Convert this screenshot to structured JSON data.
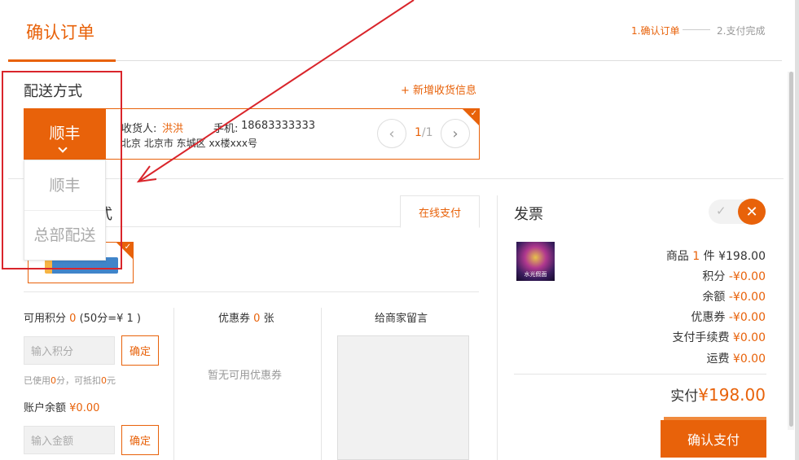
{
  "header": {
    "title": "确认订单",
    "step1": "1.确认订单",
    "step2": "2.支付完成"
  },
  "delivery": {
    "title": "配送方式",
    "add_address": "+ 新增收货信息",
    "selected": "顺丰",
    "options": [
      "顺丰",
      "总部配送"
    ]
  },
  "address": {
    "receiver_label": "收货人:",
    "receiver_name": "洪洪",
    "phone_label": "手机:",
    "phone": "18683333333",
    "line": "北京 北京市 东城区 xx楼xxx号",
    "page_current": "1",
    "page_total": "/1"
  },
  "payment": {
    "title_partial": "式",
    "tab_online": "在线支付"
  },
  "points": {
    "label": "可用积分",
    "count": "0",
    "rate": "(50分=¥ 1 )",
    "placeholder": "输入积分",
    "confirm": "确定",
    "used_prefix": "已使用",
    "used_points": "0",
    "used_mid": "分，可抵扣",
    "used_amount": "0",
    "used_suffix": "元"
  },
  "balance": {
    "label": "账户余额",
    "amount": "¥0.00",
    "placeholder": "输入金额",
    "confirm": "确定"
  },
  "coupon": {
    "label": "优惠券",
    "count": "0",
    "unit": "张",
    "empty": "暂无可用优惠券"
  },
  "message": {
    "label": "给商家留言"
  },
  "invoice": {
    "title": "发票",
    "thumb_caption": "水光假面"
  },
  "summary": {
    "goods_label": "商品",
    "goods_count": "1",
    "goods_unit": "件",
    "goods_price": "¥198.00",
    "points_label": "积分",
    "points_value": "-¥0.00",
    "balance_label": "余额",
    "balance_value": "-¥0.00",
    "coupon_label": "优惠券",
    "coupon_value": "-¥0.00",
    "fee_label": "支付手续费",
    "fee_value": "¥0.00",
    "shipping_label": "运费",
    "shipping_value": "¥0.00",
    "total_label": "实付",
    "total_value": "¥198.00",
    "pay_button": "确认支付"
  },
  "colors": {
    "accent": "#e8620a",
    "annotation": "#d9252b"
  }
}
